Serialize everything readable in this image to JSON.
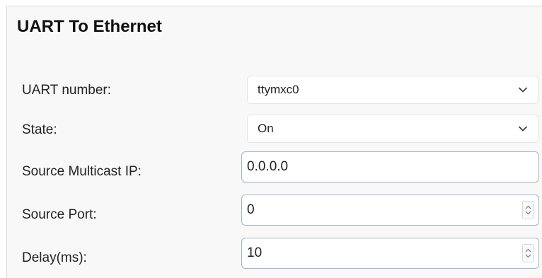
{
  "panel": {
    "title": "UART To Ethernet"
  },
  "fields": {
    "uart_number": {
      "label": "UART number:",
      "value": "ttymxc0",
      "icon": "chevron-down-icon"
    },
    "state": {
      "label": "State:",
      "value": "On",
      "icon": "chevron-down-icon"
    },
    "source_multicast_ip": {
      "label": "Source Multicast IP:",
      "value": "0.0.0.0"
    },
    "source_port": {
      "label": "Source Port:",
      "value": "0",
      "icon": "spinner-icon"
    },
    "delay": {
      "label": "Delay(ms):",
      "value": "10",
      "icon": "spinner-icon"
    }
  }
}
